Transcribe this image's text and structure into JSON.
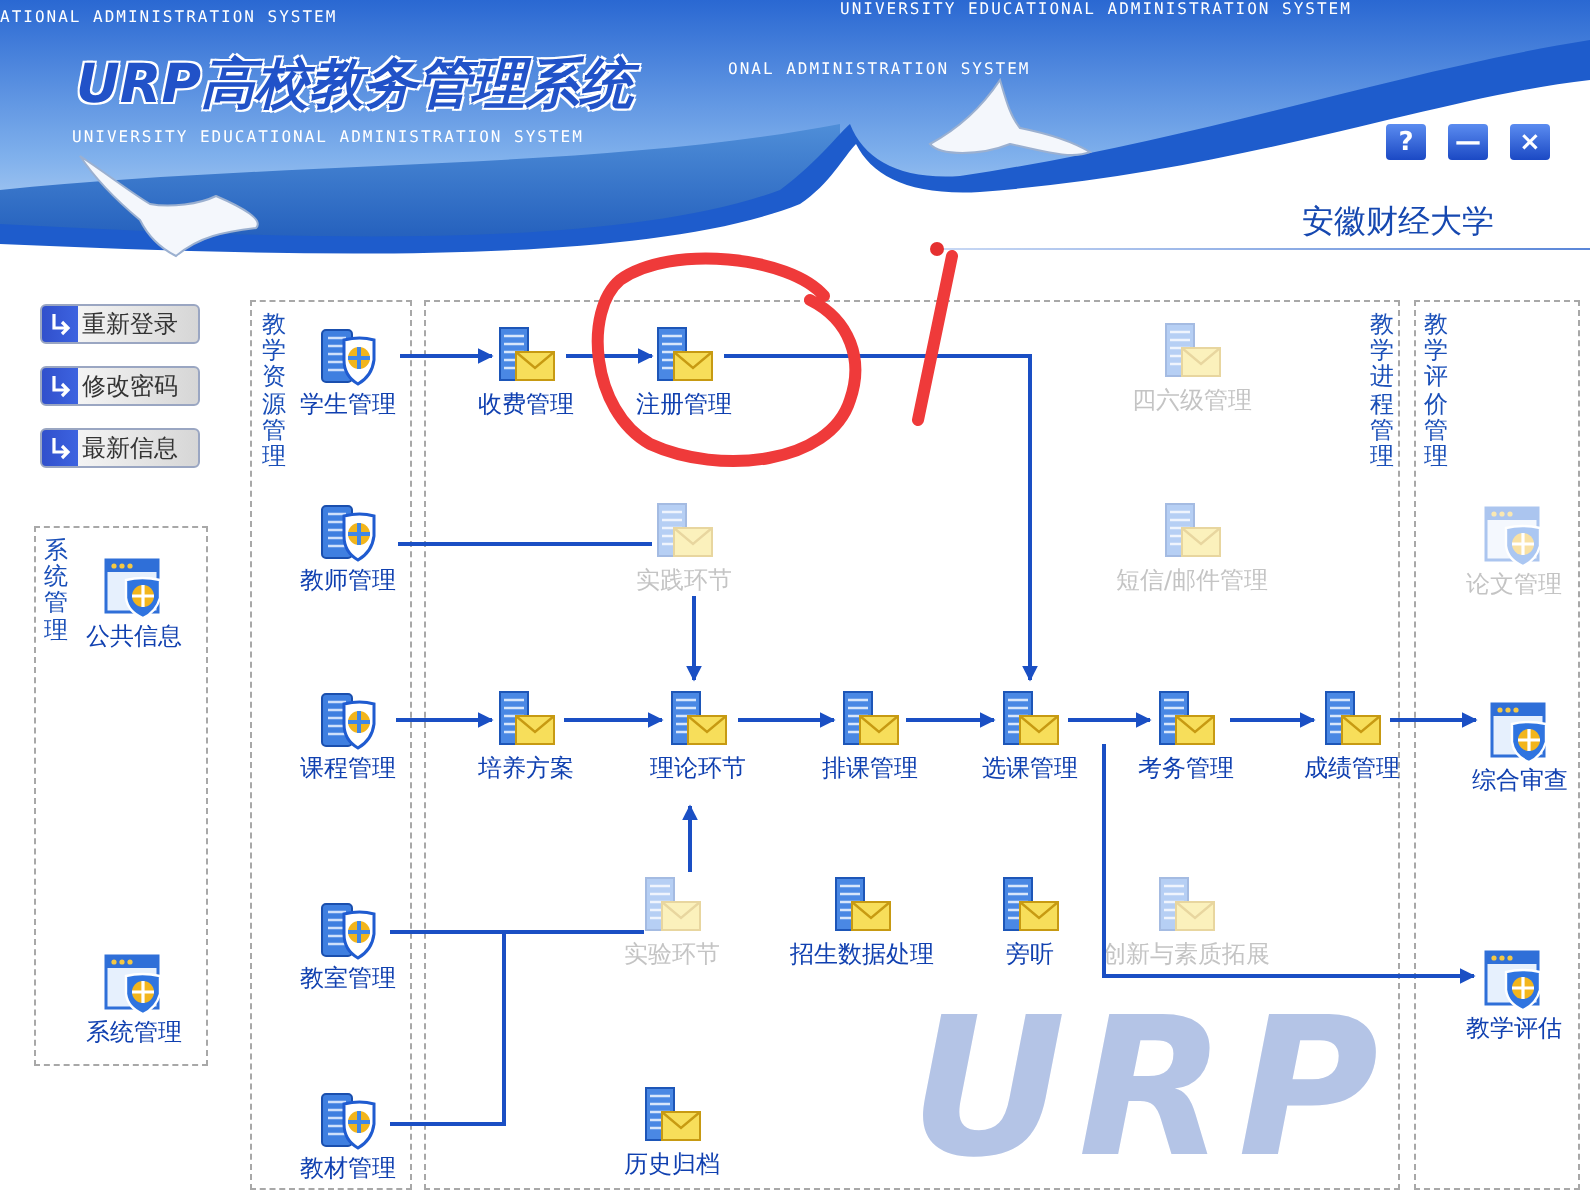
{
  "header": {
    "title": "URP高校教务管理系统",
    "banner_texts": [
      "ATIONAL ADMINISTRATION SYSTEM",
      "UNIVERSITY EDUCATIONAL ADMINISTRATION SYSTEM",
      "ONAL ADMINISTRATION SYSTEM",
      "UNIVERSITY EDUCATIONAL ADMINISTRATION SYSTEM"
    ],
    "window_buttons": [
      "?",
      "—",
      "×"
    ],
    "university": "安徽财经大学"
  },
  "side_buttons": [
    "重新登录",
    "修改密码",
    "最新信息"
  ],
  "sections": [
    {
      "title": "系统管理"
    },
    {
      "title": "教学资源管理"
    },
    {
      "title": "教学进程管理"
    },
    {
      "title": "教学评价管理"
    }
  ],
  "nodes": [
    {
      "label": "公共信息",
      "kind": "window",
      "disabled": false
    },
    {
      "label": "系统管理",
      "kind": "window",
      "disabled": false
    },
    {
      "label": "学生管理",
      "kind": "shield",
      "disabled": false
    },
    {
      "label": "收费管理",
      "kind": "mail",
      "disabled": false
    },
    {
      "label": "注册管理",
      "kind": "mail",
      "disabled": false
    },
    {
      "label": "四六级管理",
      "kind": "mail",
      "disabled": true
    },
    {
      "label": "教师管理",
      "kind": "shield",
      "disabled": false
    },
    {
      "label": "实践环节",
      "kind": "mail",
      "disabled": true
    },
    {
      "label": "短信/邮件管理",
      "kind": "mail",
      "disabled": true
    },
    {
      "label": "论文管理",
      "kind": "window",
      "disabled": true
    },
    {
      "label": "课程管理",
      "kind": "shield",
      "disabled": false
    },
    {
      "label": "培养方案",
      "kind": "mail",
      "disabled": false
    },
    {
      "label": "理论环节",
      "kind": "mail",
      "disabled": false
    },
    {
      "label": "排课管理",
      "kind": "mail",
      "disabled": false
    },
    {
      "label": "选课管理",
      "kind": "mail",
      "disabled": false
    },
    {
      "label": "考务管理",
      "kind": "mail",
      "disabled": false
    },
    {
      "label": "成绩管理",
      "kind": "mail",
      "disabled": false
    },
    {
      "label": "综合审查",
      "kind": "window",
      "disabled": false
    },
    {
      "label": "教室管理",
      "kind": "shield",
      "disabled": false
    },
    {
      "label": "实验环节",
      "kind": "mail",
      "disabled": true
    },
    {
      "label": "招生数据处理",
      "kind": "mail",
      "disabled": false
    },
    {
      "label": "旁听",
      "kind": "mail",
      "disabled": false
    },
    {
      "label": "创新与素质拓展",
      "kind": "mail",
      "disabled": true
    },
    {
      "label": "教学评估",
      "kind": "window",
      "disabled": false
    },
    {
      "label": "教材管理",
      "kind": "shield",
      "disabled": false
    },
    {
      "label": "历史归档",
      "kind": "mail",
      "disabled": false
    }
  ],
  "background_logo": "URP"
}
